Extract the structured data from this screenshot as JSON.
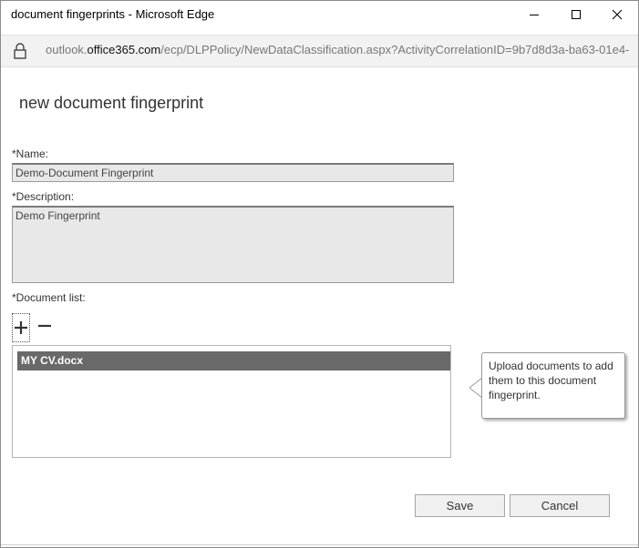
{
  "window": {
    "title": "document fingerprints - Microsoft Edge",
    "minimize_icon": "minimize-icon",
    "maximize_icon": "maximize-icon",
    "close_icon": "close-icon"
  },
  "address": {
    "url_prefix": "outlook.",
    "url_host": "office365.com",
    "url_path": "/ecp/DLPPolicy/NewDataClassification.aspx?ActivityCorrelationID=9b7d8d3a-ba63-01e4-",
    "lock_icon": "lock-icon"
  },
  "form": {
    "title": "new document fingerprint",
    "name_label": "*Name:",
    "name_value": "Demo-Document Fingerprint",
    "description_label": "*Description:",
    "description_value": "Demo Fingerprint",
    "document_list_label": "*Document list:",
    "add_icon": "plus-icon",
    "remove_icon": "minus-icon",
    "documents": [
      "MY CV.docx"
    ],
    "callout_text": "Upload documents to add them to this document fingerprint."
  },
  "buttons": {
    "save_label": "Save",
    "cancel_label": "Cancel"
  }
}
